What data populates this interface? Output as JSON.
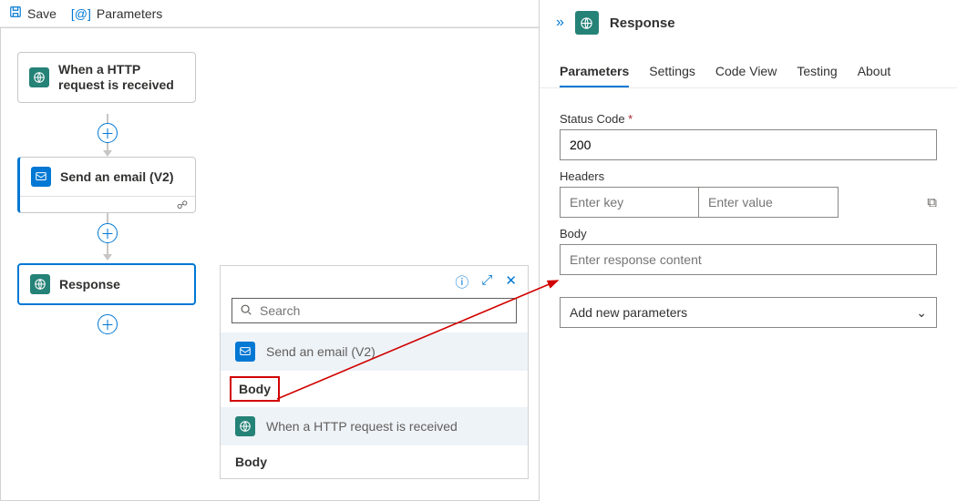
{
  "toolbar": {
    "save": "Save",
    "parameters": "Parameters"
  },
  "nodes": {
    "trigger": {
      "title": "When a HTTP request is received"
    },
    "email": {
      "title": "Send an email (V2)"
    },
    "response": {
      "title": "Response"
    }
  },
  "picker": {
    "search_placeholder": "Search",
    "items": [
      {
        "label": "Send an email (V2)",
        "icon": "mail"
      },
      {
        "sublabel": "Body",
        "highlight": true
      },
      {
        "label": "When a HTTP request is received",
        "icon": "globe"
      },
      {
        "sublabel": "Body"
      }
    ]
  },
  "panel": {
    "title": "Response",
    "tabs": [
      "Parameters",
      "Settings",
      "Code View",
      "Testing",
      "About"
    ],
    "active_tab": "Parameters",
    "status_label": "Status Code",
    "status_value": "200",
    "headers_label": "Headers",
    "headers_key_placeholder": "Enter key",
    "headers_value_placeholder": "Enter value",
    "body_label": "Body",
    "body_placeholder": "Enter response content",
    "add_new": "Add new parameters"
  }
}
